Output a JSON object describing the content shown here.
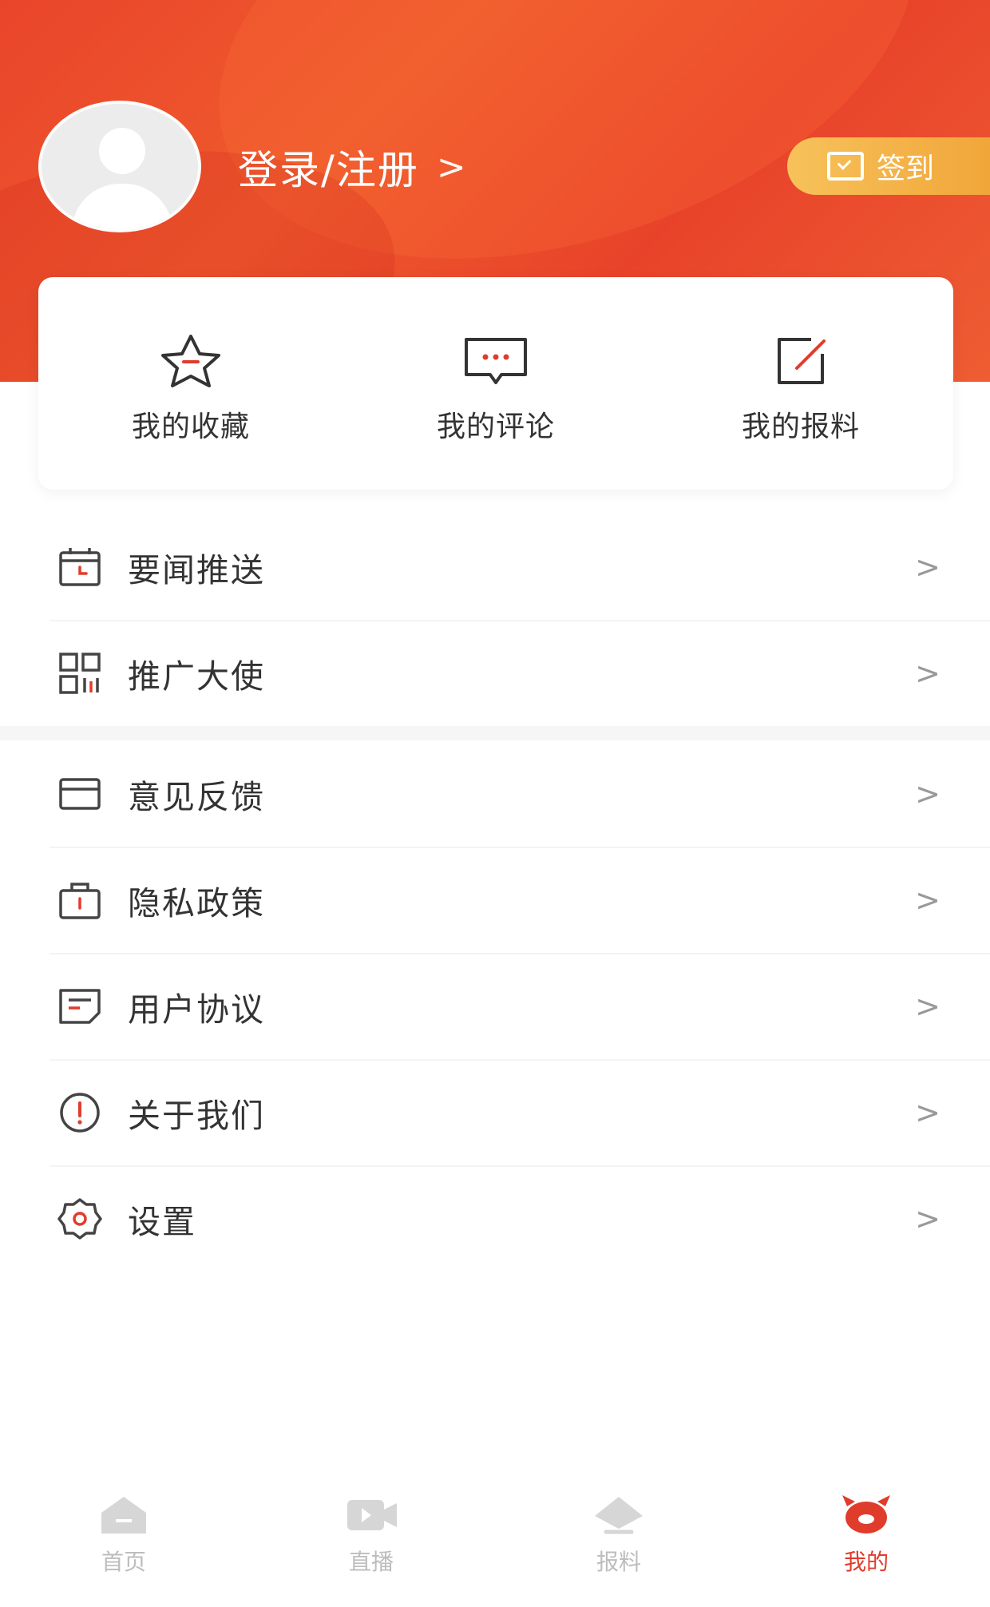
{
  "header": {
    "login_label": "登录/注册",
    "login_chevron": ">",
    "checkin_label": "签到"
  },
  "quick_actions": [
    {
      "label": "我的收藏",
      "icon": "star-icon"
    },
    {
      "label": "我的评论",
      "icon": "comment-icon"
    },
    {
      "label": "我的报料",
      "icon": "edit-icon"
    }
  ],
  "menu_group1": [
    {
      "label": "要闻推送",
      "icon": "calendar-icon"
    },
    {
      "label": "推广大使",
      "icon": "qr-code-icon"
    }
  ],
  "menu_group2": [
    {
      "label": "意见反馈",
      "icon": "mail-icon"
    },
    {
      "label": "隐私政策",
      "icon": "lock-icon"
    },
    {
      "label": "用户协议",
      "icon": "document-icon"
    },
    {
      "label": "关于我们",
      "icon": "info-icon"
    },
    {
      "label": "设置",
      "icon": "gear-icon"
    }
  ],
  "menu_arrow": ">",
  "tabbar": [
    {
      "label": "首页",
      "icon": "home-icon",
      "active": false
    },
    {
      "label": "直播",
      "icon": "video-icon",
      "active": false
    },
    {
      "label": "报料",
      "icon": "report-icon",
      "active": false
    },
    {
      "label": "我的",
      "icon": "profile-icon",
      "active": true
    }
  ],
  "colors": {
    "header": "#e9452b",
    "checkin": "#f1a63a",
    "accent": "#e03c2c",
    "icon_stroke": "#444444"
  }
}
